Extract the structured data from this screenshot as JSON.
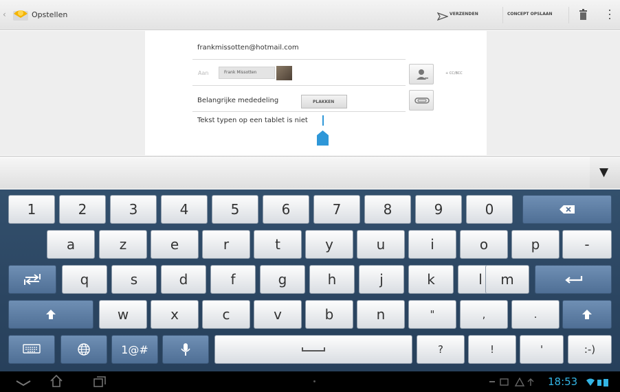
{
  "action_bar": {
    "title": "Opstellen",
    "send_label": "VERZENDEN",
    "save_draft_label": "CONCEPT OPSLAAN"
  },
  "compose": {
    "from": "frankmissotten@hotmail.com",
    "to_label": "Aan",
    "recipient_name": "Frank Missotten",
    "cc_bcc_label": "+ CC/BCC",
    "subject": "Belangrijke mededeling",
    "paste_label": "PLAKKEN",
    "body": "Tekst typen op een tablet is niet"
  },
  "keyboard": {
    "rows": [
      [
        "1",
        "2",
        "3",
        "4",
        "5",
        "6",
        "7",
        "8",
        "9",
        "0",
        "⌫"
      ],
      [
        "a",
        "z",
        "e",
        "r",
        "t",
        "y",
        "u",
        "i",
        "o",
        "p",
        "-"
      ],
      [
        "⇄",
        "q",
        "s",
        "d",
        "f",
        "g",
        "h",
        "j",
        "k",
        "l",
        "m",
        "↵"
      ],
      [
        "⇧",
        "w",
        "x",
        "c",
        "v",
        "b",
        "n",
        "\"",
        ",",
        ".",
        "⇧"
      ],
      [
        "⌨",
        "◍",
        "1@#",
        "🎤",
        "␣",
        "?",
        "!",
        "'",
        ":-)"
      ]
    ]
  },
  "system_bar": {
    "time": "18:53"
  },
  "colors": {
    "keyboard_bg": "#2b4561",
    "clock": "#33b5e5",
    "cursor": "#2e97d8"
  }
}
